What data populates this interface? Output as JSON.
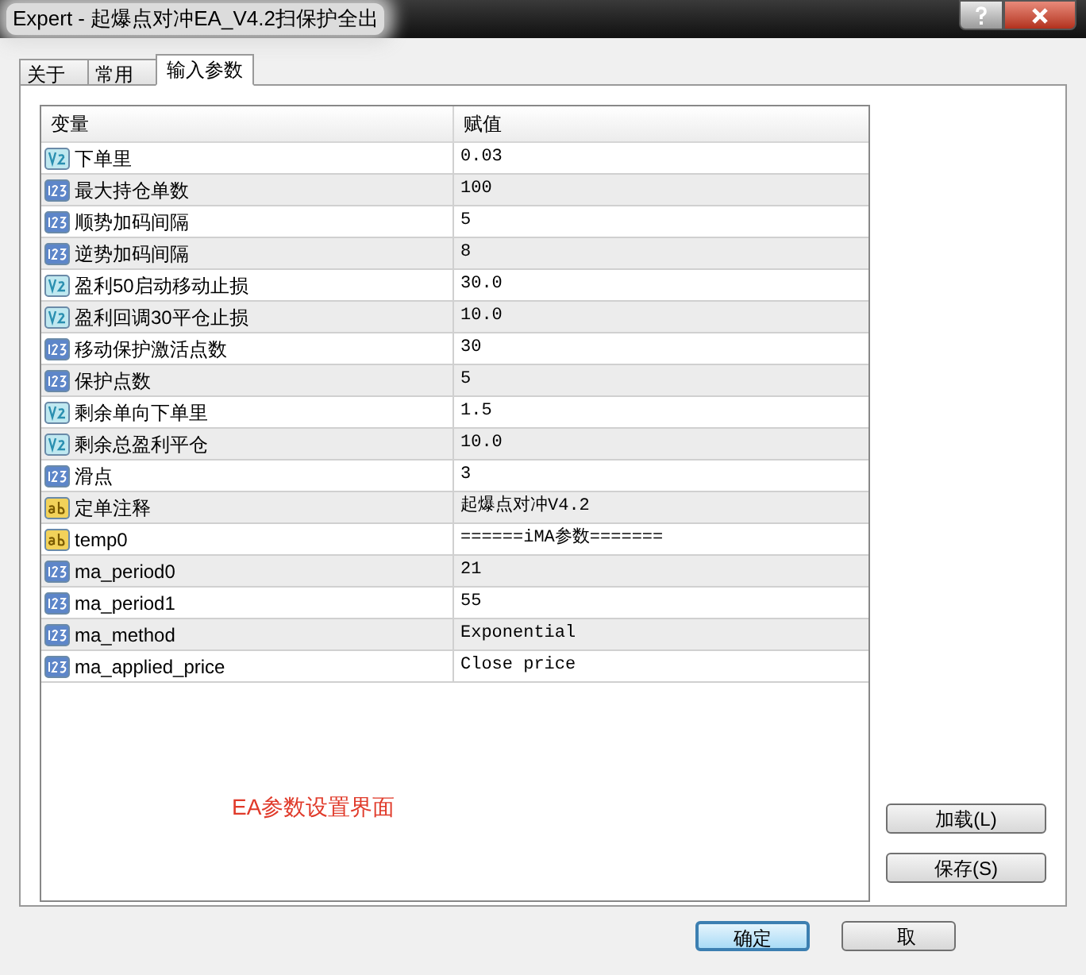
{
  "window": {
    "title": "Expert - 起爆点对冲EA_V4.2扫保护全出"
  },
  "tabs": [
    {
      "label": "关于",
      "selected": false
    },
    {
      "label": "常用",
      "selected": false
    },
    {
      "label": "输入参数",
      "selected": true
    }
  ],
  "table": {
    "columns": [
      "变量",
      "赋值"
    ],
    "rows": [
      {
        "kind": "double",
        "name": "下单里",
        "value": "0.03"
      },
      {
        "kind": "int",
        "name": "最大持仓单数",
        "value": "100"
      },
      {
        "kind": "int",
        "name": "顺势加码间隔",
        "value": "5"
      },
      {
        "kind": "int",
        "name": "逆势加码间隔",
        "value": "8"
      },
      {
        "kind": "double",
        "name": "盈利50启动移动止损",
        "value": "30.0"
      },
      {
        "kind": "double",
        "name": "盈利回调30平仓止损",
        "value": "10.0"
      },
      {
        "kind": "int",
        "name": "移动保护激活点数",
        "value": "30"
      },
      {
        "kind": "int",
        "name": "保护点数",
        "value": "5"
      },
      {
        "kind": "double",
        "name": "剩余单向下单里",
        "value": "1.5"
      },
      {
        "kind": "double",
        "name": "剩余总盈利平仓",
        "value": "10.0"
      },
      {
        "kind": "int",
        "name": "滑点",
        "value": "3"
      },
      {
        "kind": "string",
        "name": "定单注释",
        "value": "起爆点对冲V4.2"
      },
      {
        "kind": "string",
        "name": "temp0",
        "value": "======iMA参数======="
      },
      {
        "kind": "int",
        "name": "ma_period0",
        "value": "21"
      },
      {
        "kind": "int",
        "name": "ma_period1",
        "value": "55"
      },
      {
        "kind": "int",
        "name": "ma_method",
        "value": "Exponential"
      },
      {
        "kind": "int",
        "name": "ma_applied_price",
        "value": "Close price"
      }
    ]
  },
  "annotation": "EA参数设置界面",
  "side_buttons": [
    "加载(L)",
    "保存(S)"
  ],
  "buttons": [
    {
      "label": "确定",
      "default": true
    },
    {
      "label": "取",
      "default": false
    }
  ]
}
